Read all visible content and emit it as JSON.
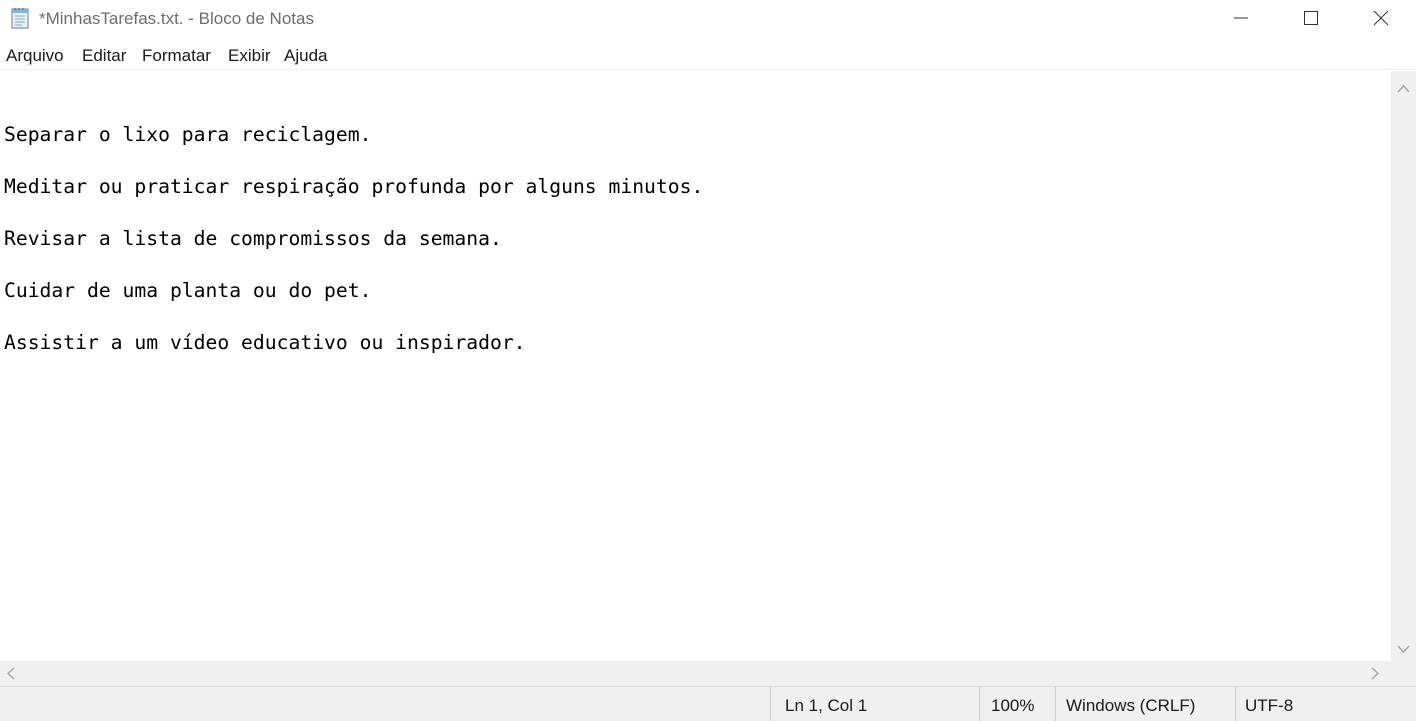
{
  "window": {
    "title": "*MinhasTarefas.txt. - Bloco de Notas",
    "icon": "notepad-icon"
  },
  "menu": {
    "items": [
      {
        "label": "Arquivo"
      },
      {
        "label": "Editar"
      },
      {
        "label": "Formatar"
      },
      {
        "label": "Exibir"
      },
      {
        "label": "Ajuda"
      }
    ]
  },
  "editor": {
    "lines": [
      "Separar o lixo para reciclagem.",
      "Meditar ou praticar respiração profunda por alguns minutos.",
      "Revisar a lista de compromissos da semana.",
      "Cuidar de uma planta ou do pet.",
      "Assistir a um vídeo educativo ou inspirador."
    ]
  },
  "status": {
    "position": "Ln 1, Col 1",
    "zoom": "100%",
    "line_ending": "Windows (CRLF)",
    "encoding": "UTF-8"
  }
}
